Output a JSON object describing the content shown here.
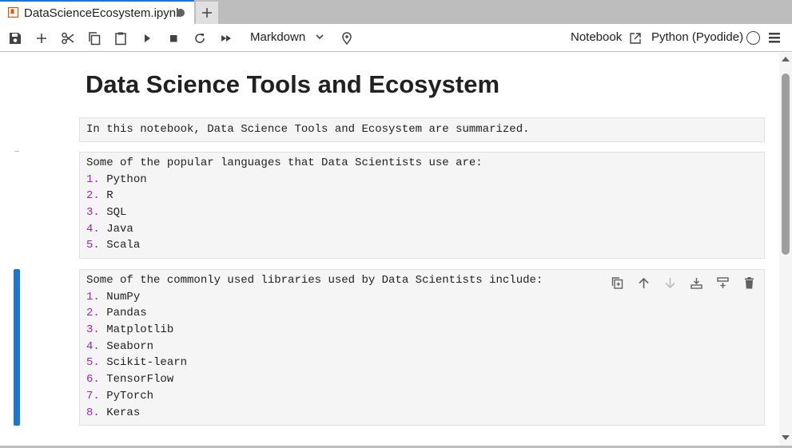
{
  "tab": {
    "title": "DataScienceEcosystem.ipynb",
    "icon": "notebook-icon"
  },
  "toolbar": {
    "cell_type": "Markdown",
    "notebook_label": "Notebook",
    "kernel_label": "Python (Pyodide)"
  },
  "notebook": {
    "heading": "Data Science Tools and Ecosystem",
    "cell1": {
      "text": "In this notebook, Data Science Tools and Ecosystem are summarized."
    },
    "cell2": {
      "intro": "Some of the popular languages that Data Scientists use are:",
      "items": [
        {
          "num": "1.",
          "text": "Python"
        },
        {
          "num": "2.",
          "text": "R"
        },
        {
          "num": "3.",
          "text": "SQL"
        },
        {
          "num": "4.",
          "text": "Java"
        },
        {
          "num": "5.",
          "text": "Scala"
        }
      ]
    },
    "cell3": {
      "intro": "Some of the commonly used libraries used by Data Scientists include:",
      "items": [
        {
          "num": "1.",
          "text": "NumPy"
        },
        {
          "num": "2.",
          "text": "Pandas"
        },
        {
          "num": "3.",
          "text": "Matplotlib"
        },
        {
          "num": "4.",
          "text": "Seaborn"
        },
        {
          "num": "5.",
          "text": "Scikit-learn"
        },
        {
          "num": "6.",
          "text": "TensorFlow"
        },
        {
          "num": "7.",
          "text": "PyTorch"
        },
        {
          "num": "8.",
          "text": "Keras"
        }
      ]
    }
  },
  "colors": {
    "accent": "#1976d2",
    "list_number": "#9c27b0",
    "cell_bg": "#f5f5f5"
  }
}
